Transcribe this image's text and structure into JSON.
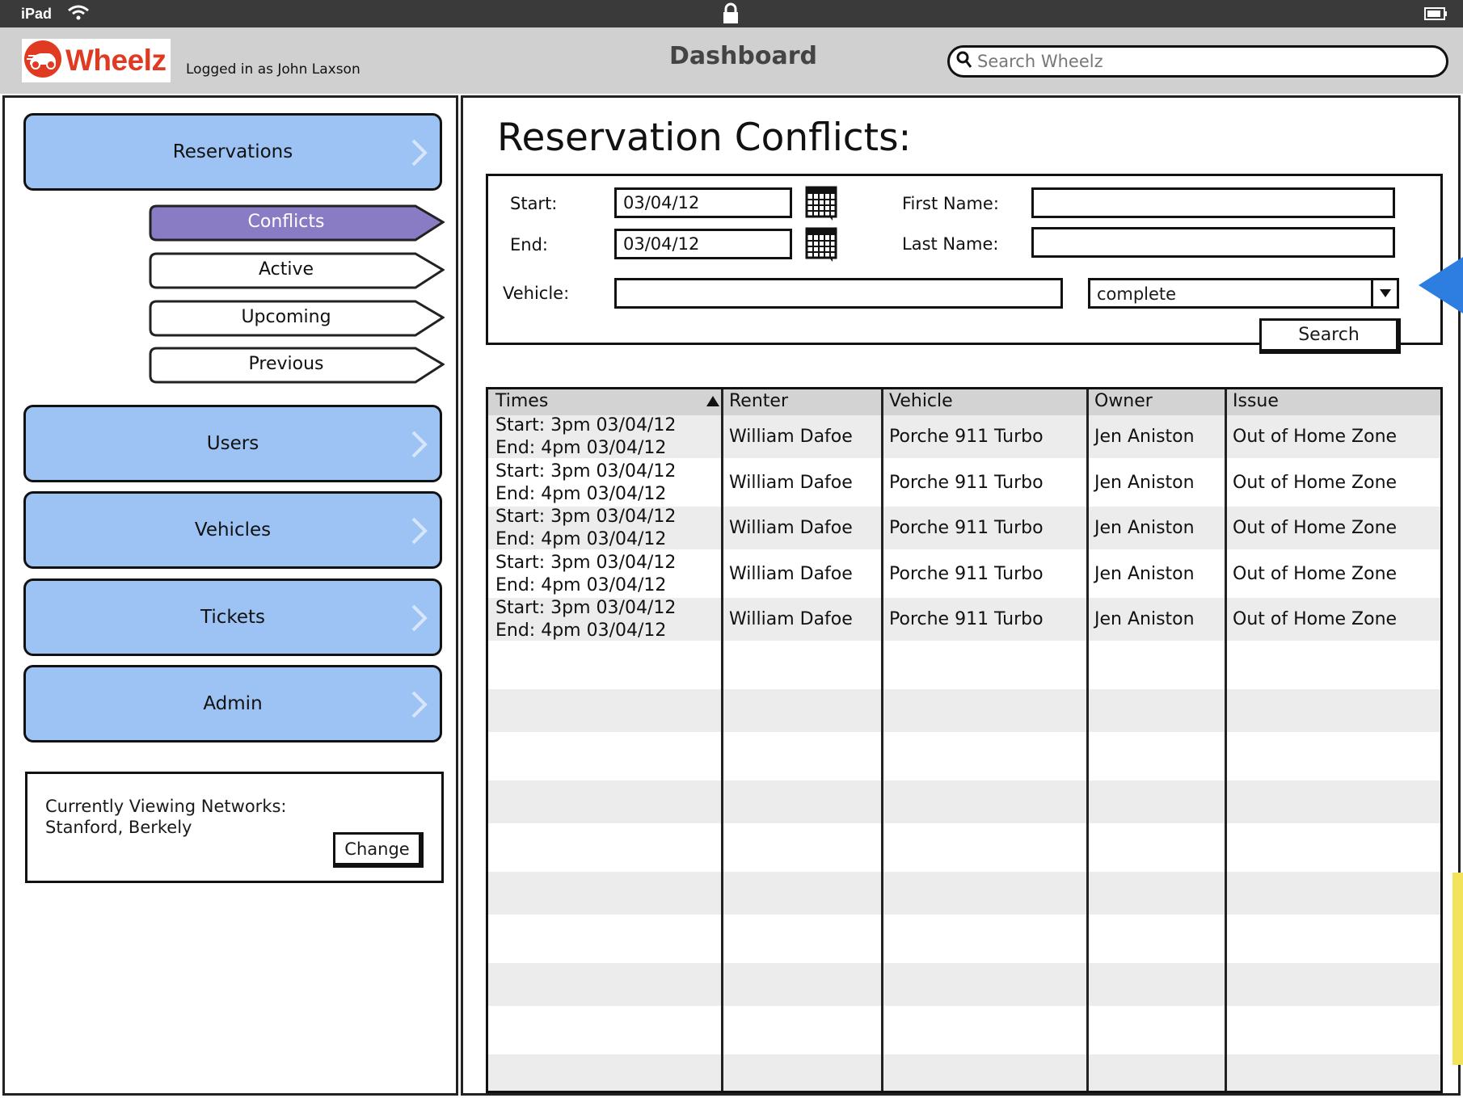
{
  "status_bar": {
    "device": "iPad"
  },
  "header": {
    "brand": "Wheelz",
    "logged_in": "Logged in as John Laxson",
    "title": "Dashboard",
    "search_placeholder": "Search Wheelz"
  },
  "sidebar": {
    "nav": [
      {
        "label": "Reservations"
      },
      {
        "label": "Users"
      },
      {
        "label": "Vehicles"
      },
      {
        "label": "Tickets"
      },
      {
        "label": "Admin"
      }
    ],
    "subtabs": [
      {
        "label": "Conflicts",
        "active": true
      },
      {
        "label": "Active",
        "active": false
      },
      {
        "label": "Upcoming",
        "active": false
      },
      {
        "label": "Previous",
        "active": false
      }
    ],
    "networks": {
      "label": "Currently Viewing Networks:",
      "value": "Stanford, Berkely",
      "change_label": "Change"
    }
  },
  "main": {
    "title": "Reservation Conflicts:",
    "filters": {
      "start_label": "Start:",
      "start_value": "03/04/12",
      "end_label": "End:",
      "end_value": "03/04/12",
      "first_name_label": "First Name:",
      "first_name_value": "",
      "last_name_label": "Last Name:",
      "last_name_value": "",
      "vehicle_label": "Vehicle:",
      "vehicle_value": "",
      "status_value": "complete",
      "search_label": "Search"
    },
    "table": {
      "columns": [
        "Times",
        "Renter",
        "Vehicle",
        "Owner",
        "Issue"
      ],
      "rows": [
        {
          "start": "Start: 3pm 03/04/12",
          "end": "End: 4pm 03/04/12",
          "renter": "William Dafoe",
          "vehicle": "Porche 911 Turbo",
          "owner": "Jen Aniston",
          "issue": "Out of Home Zone"
        },
        {
          "start": "Start: 3pm 03/04/12",
          "end": "End: 4pm 03/04/12",
          "renter": "William Dafoe",
          "vehicle": "Porche 911 Turbo",
          "owner": "Jen Aniston",
          "issue": "Out of Home Zone"
        },
        {
          "start": "Start: 3pm 03/04/12",
          "end": "End: 4pm 03/04/12",
          "renter": "William Dafoe",
          "vehicle": "Porche 911 Turbo",
          "owner": "Jen Aniston",
          "issue": "Out of Home Zone"
        },
        {
          "start": "Start: 3pm 03/04/12",
          "end": "End: 4pm 03/04/12",
          "renter": "William Dafoe",
          "vehicle": "Porche 911 Turbo",
          "owner": "Jen Aniston",
          "issue": "Out of Home Zone"
        },
        {
          "start": "Start: 3pm 03/04/12",
          "end": "End: 4pm 03/04/12",
          "renter": "William Dafoe",
          "vehicle": "Porche 911 Turbo",
          "owner": "Jen Aniston",
          "issue": "Out of Home Zone"
        }
      ]
    }
  },
  "colors": {
    "nav_blue": "#9dc3f5",
    "active_tab": "#8a7cc4",
    "brand_red": "#e03b22",
    "marker_blue": "#2e7de0"
  }
}
